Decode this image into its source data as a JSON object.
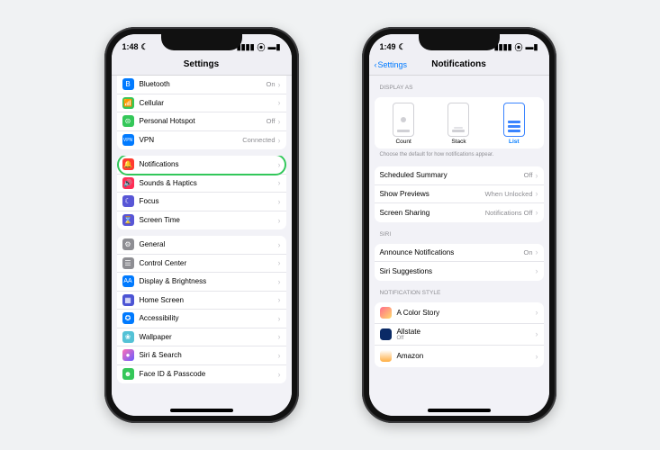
{
  "phone_left": {
    "time": "1:48",
    "title": "Settings",
    "group1": [
      {
        "name": "bluetooth",
        "label": "Bluetooth",
        "value": "On",
        "glyph": "B"
      },
      {
        "name": "cellular",
        "label": "Cellular",
        "value": "",
        "glyph": "📶"
      },
      {
        "name": "hotspot",
        "label": "Personal Hotspot",
        "value": "Off",
        "glyph": "⊝"
      },
      {
        "name": "vpn",
        "label": "VPN",
        "value": "Connected",
        "glyph": "VPN"
      }
    ],
    "group2": [
      {
        "name": "notifications",
        "label": "Notifications",
        "glyph": "🔔",
        "highlight": true
      },
      {
        "name": "sounds",
        "label": "Sounds & Haptics",
        "glyph": "🔊"
      },
      {
        "name": "focus",
        "label": "Focus",
        "glyph": "☾"
      },
      {
        "name": "screentime",
        "label": "Screen Time",
        "glyph": "⌛"
      }
    ],
    "group3": [
      {
        "name": "general",
        "label": "General",
        "glyph": "⚙"
      },
      {
        "name": "controlcenter",
        "label": "Control Center",
        "glyph": "☰"
      },
      {
        "name": "display",
        "label": "Display & Brightness",
        "glyph": "AA"
      },
      {
        "name": "homescreen",
        "label": "Home Screen",
        "glyph": "▦"
      },
      {
        "name": "accessibility",
        "label": "Accessibility",
        "glyph": "✪"
      },
      {
        "name": "wallpaper",
        "label": "Wallpaper",
        "glyph": "❀"
      },
      {
        "name": "siri",
        "label": "Siri & Search",
        "glyph": "●"
      },
      {
        "name": "faceid",
        "label": "Face ID & Passcode",
        "glyph": "☻"
      }
    ]
  },
  "phone_right": {
    "time": "1:49",
    "back_label": "Settings",
    "title": "Notifications",
    "display_as_header": "Display As",
    "display_as": [
      {
        "name": "count",
        "label": "Count",
        "selected": false
      },
      {
        "name": "stack",
        "label": "Stack",
        "selected": false
      },
      {
        "name": "list",
        "label": "List",
        "selected": true
      }
    ],
    "display_as_footer": "Choose the default for how notifications appear.",
    "groupA": [
      {
        "name": "scheduled-summary",
        "label": "Scheduled Summary",
        "value": "Off"
      },
      {
        "name": "show-previews",
        "label": "Show Previews",
        "value": "When Unlocked"
      },
      {
        "name": "screen-sharing",
        "label": "Screen Sharing",
        "value": "Notifications Off"
      }
    ],
    "siri_header": "Siri",
    "groupB": [
      {
        "name": "announce",
        "label": "Announce Notifications",
        "value": "On"
      },
      {
        "name": "siri-sugg",
        "label": "Siri Suggestions",
        "value": ""
      }
    ],
    "style_header": "Notification Style",
    "apps": [
      {
        "name": "a-color-story",
        "label": "A Color Story",
        "sub": "",
        "color": "linear-gradient(135deg,#ff6b8b,#ffdb6b)"
      },
      {
        "name": "allstate",
        "label": "Allstate",
        "sub": "Off",
        "color": "#0a2a66"
      },
      {
        "name": "amazon",
        "label": "Amazon",
        "sub": "",
        "color": "linear-gradient(180deg,#fff,#ffae42)"
      }
    ]
  }
}
